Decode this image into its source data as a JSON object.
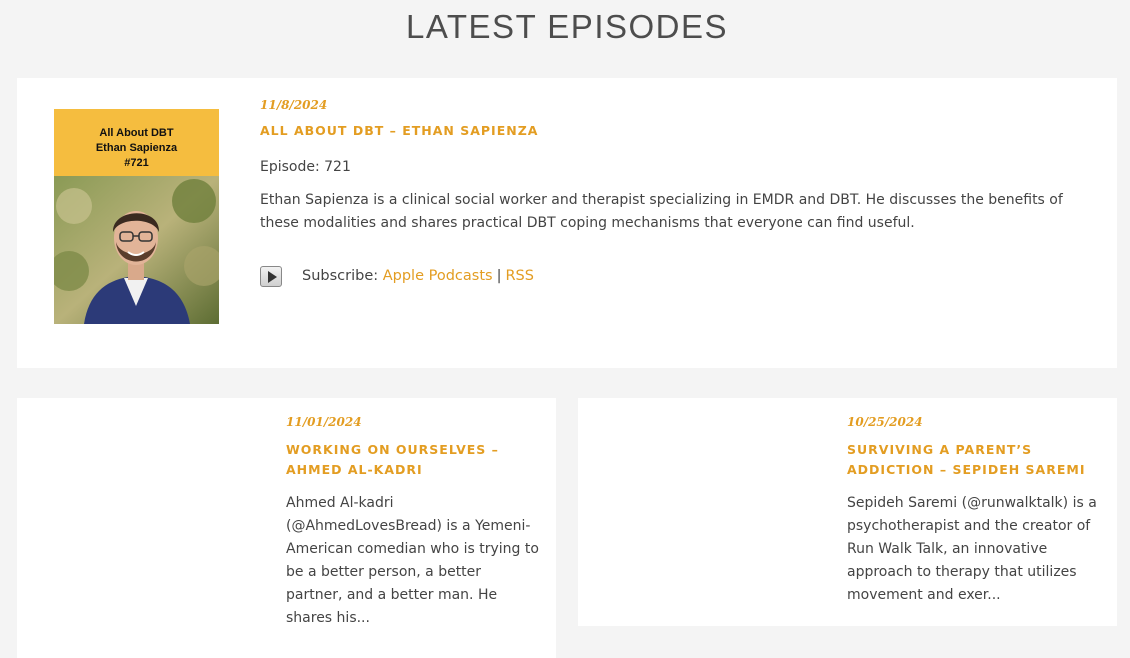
{
  "section_title": "LATEST EPISODES",
  "featured": {
    "cover": {
      "line1": "All About DBT",
      "line2": "Ethan Sapienza",
      "line3": "#721"
    },
    "date": "11/8/2024",
    "title": "ALL ABOUT DBT – ETHAN SAPIENZA",
    "episode": "Episode: 721",
    "description": "Ethan Sapienza is a clinical social worker and therapist specializing in EMDR and DBT. He discusses the benefits of these modalities and shares practical DBT coping mechanisms that everyone can find useful.",
    "subscribe_label": "Subscribe:",
    "apple_link": "Apple Podcasts",
    "separator": "|",
    "rss_link": "RSS",
    "play_icon": "play-icon"
  },
  "episodes": [
    {
      "date": "11/01/2024",
      "title": "WORKING ON OURSELVES – AHMED AL-KADRI",
      "excerpt": "Ahmed Al-kadri (@AhmedLovesBread) is a Yemeni-American comedian who is trying to be a better person, a better partner, and a better man. He shares his..."
    },
    {
      "date": "10/25/2024",
      "title": "SURVIVING A PARENT’S ADDICTION – SEPIDEH SAREMI",
      "excerpt": "Sepideh Saremi (@runwalktalk) is a psychotherapist and the creator of Run Walk Talk, an innovative approach to therapy that utilizes movement and exer..."
    }
  ],
  "colors": {
    "accent": "#e39d22",
    "background": "#f4f4f4",
    "card": "#ffffff",
    "text": "#444444",
    "cover_banner": "#f5bd3f"
  }
}
